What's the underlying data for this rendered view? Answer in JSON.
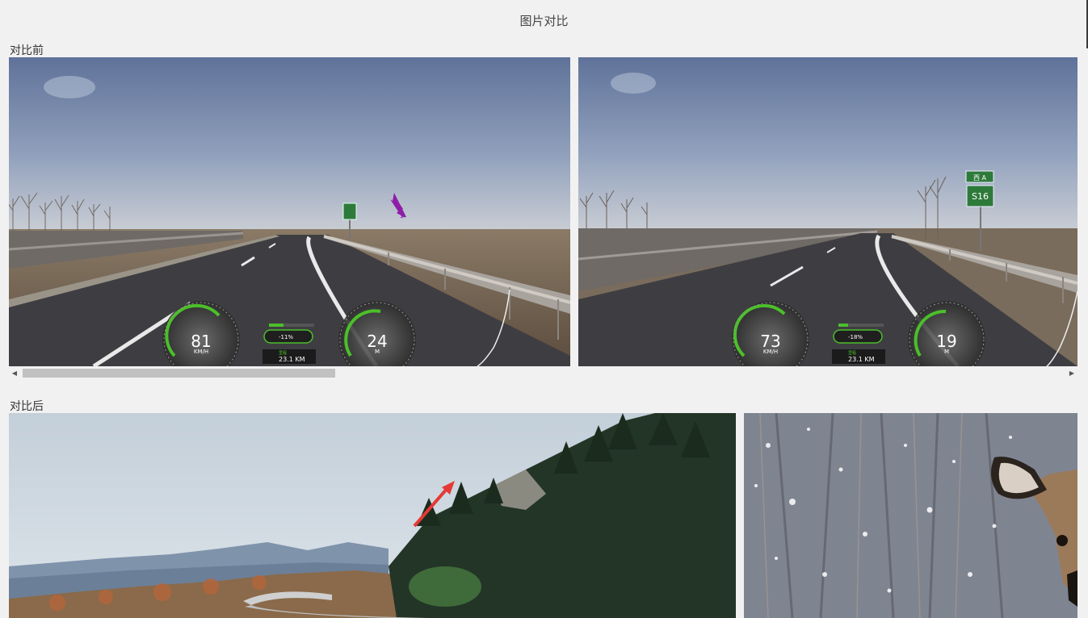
{
  "page": {
    "title": "图片对比"
  },
  "before": {
    "label": "对比前",
    "images": [
      {
        "speed": "81",
        "speed_unit": "KM/H",
        "slope": "-11%",
        "distance": "23.1 KM",
        "distance_label": "里程",
        "altitude": "24",
        "altitude_unit": "M"
      },
      {
        "speed": "73",
        "speed_unit": "KM/H",
        "slope": "-18%",
        "distance": "23.1 KM",
        "distance_label": "里程",
        "altitude": "19",
        "altitude_unit": "M",
        "sign_top": "西 A",
        "sign_main": "S16"
      }
    ],
    "scroll": {
      "thumb_fraction": 0.3
    }
  },
  "after": {
    "label": "对比后"
  },
  "icons": {
    "scroll_left": "triangle-left-icon",
    "scroll_right": "triangle-right-icon",
    "annotation_arrow_purple": "arrow-icon",
    "annotation_arrow_red": "arrow-icon"
  },
  "colors": {
    "background": "#f1f1f1",
    "arrow_purple": "#8e1ea8",
    "arrow_red": "#e53935",
    "hud_green": "#4bbf2a"
  }
}
